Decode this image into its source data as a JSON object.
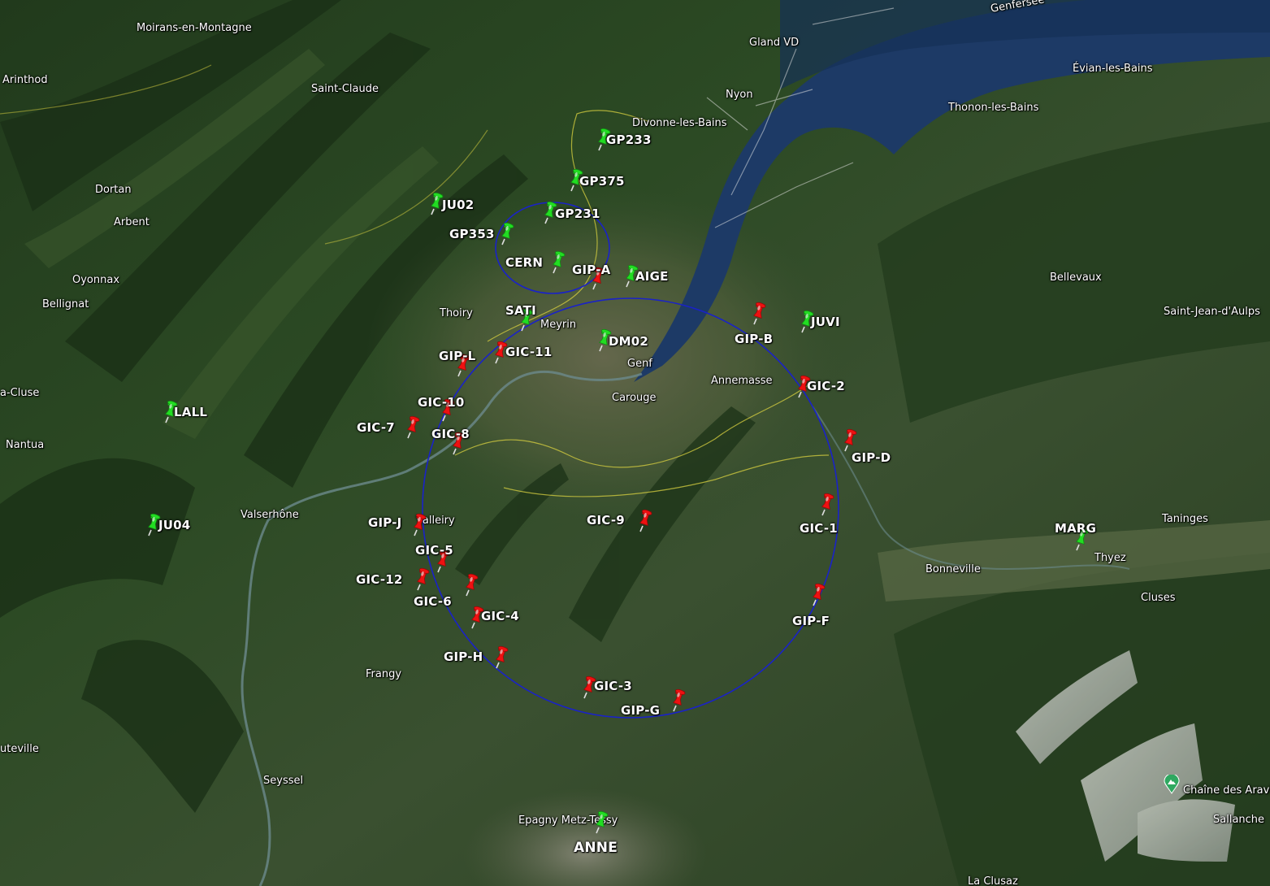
{
  "colors": {
    "ring": "#1a22c8",
    "pin_green": "#22dd22",
    "pin_red": "#ee1111",
    "lake": "#1d3a66",
    "border_yellow": "#d8d040",
    "border_white": "#e8e8e8"
  },
  "places": [
    {
      "id": "genfersee",
      "text": "Genfersee"
    },
    {
      "id": "moirans",
      "text": "Moirans-en-Montagne"
    },
    {
      "id": "gland",
      "text": "Gland VD"
    },
    {
      "id": "arinthod",
      "text": "Arinthod"
    },
    {
      "id": "saint-claude",
      "text": "Saint-Claude"
    },
    {
      "id": "nyon",
      "text": "Nyon"
    },
    {
      "id": "evian",
      "text": "Évian-les-Bains"
    },
    {
      "id": "thonon",
      "text": "Thonon-les-Bains"
    },
    {
      "id": "divonne",
      "text": "Divonne-les-Bains"
    },
    {
      "id": "dortan",
      "text": "Dortan"
    },
    {
      "id": "arbent",
      "text": "Arbent"
    },
    {
      "id": "oyonnax",
      "text": "Oyonnax"
    },
    {
      "id": "bellevaux",
      "text": "Bellevaux"
    },
    {
      "id": "bellignat",
      "text": "Bellignat"
    },
    {
      "id": "thoiry",
      "text": "Thoiry"
    },
    {
      "id": "saint-jean",
      "text": "Saint-Jean-d'Aulps"
    },
    {
      "id": "meyrin",
      "text": "Meyrin"
    },
    {
      "id": "genf",
      "text": "Genf"
    },
    {
      "id": "annemasse",
      "text": "Annemasse"
    },
    {
      "id": "carouge",
      "text": "Carouge"
    },
    {
      "id": "cluse",
      "text": "a-Cluse"
    },
    {
      "id": "nantua",
      "text": "Nantua"
    },
    {
      "id": "valserhone",
      "text": "Valserhône"
    },
    {
      "id": "valleiry",
      "text": "Valleiry"
    },
    {
      "id": "taninges",
      "text": "Taninges"
    },
    {
      "id": "thyez",
      "text": "Thyez"
    },
    {
      "id": "bonneville",
      "text": "Bonneville"
    },
    {
      "id": "cluses",
      "text": "Cluses"
    },
    {
      "id": "frangy",
      "text": "Frangy"
    },
    {
      "id": "uteville",
      "text": "uteville"
    },
    {
      "id": "seyssel",
      "text": "Seyssel"
    },
    {
      "id": "aravis",
      "text": "Chaîne des Aravis"
    },
    {
      "id": "sallanche",
      "text": "Sallanche"
    },
    {
      "id": "epagny",
      "text": "Epagny Metz-Tessy"
    },
    {
      "id": "clusaz",
      "text": "La Clusaz"
    }
  ],
  "pins": [
    {
      "id": "GP233",
      "label": "GP233",
      "color": "green"
    },
    {
      "id": "GP375",
      "label": "GP375",
      "color": "green"
    },
    {
      "id": "JU02",
      "label": "JU02",
      "color": "green"
    },
    {
      "id": "GP231",
      "label": "GP231",
      "color": "green"
    },
    {
      "id": "GP353",
      "label": "GP353",
      "color": "green"
    },
    {
      "id": "CERN",
      "label": "CERN",
      "color": "green"
    },
    {
      "id": "AIGE",
      "label": "AIGE",
      "color": "green"
    },
    {
      "id": "SATI",
      "label": "SATI",
      "color": "green"
    },
    {
      "id": "DM02",
      "label": "DM02",
      "color": "green"
    },
    {
      "id": "JUVI",
      "label": "JUVI",
      "color": "green"
    },
    {
      "id": "LALL",
      "label": "LALL",
      "color": "green"
    },
    {
      "id": "JU04",
      "label": "JU04",
      "color": "green"
    },
    {
      "id": "MARG",
      "label": "MARG",
      "color": "green"
    },
    {
      "id": "ANNE",
      "label": "ANNE",
      "color": "green"
    },
    {
      "id": "GIP-A",
      "label": "GIP-A",
      "color": "red"
    },
    {
      "id": "GIP-B",
      "label": "GIP-B",
      "color": "red"
    },
    {
      "id": "GIP-L",
      "label": "GIP-L",
      "color": "red"
    },
    {
      "id": "GIC-11",
      "label": "GIC-11",
      "color": "red"
    },
    {
      "id": "GIC-2",
      "label": "GIC-2",
      "color": "red"
    },
    {
      "id": "GIC-10",
      "label": "GIC-10",
      "color": "red"
    },
    {
      "id": "GIC-7",
      "label": "GIC-7",
      "color": "red"
    },
    {
      "id": "GIC-8",
      "label": "GIC-8",
      "color": "red"
    },
    {
      "id": "GIP-D",
      "label": "GIP-D",
      "color": "red"
    },
    {
      "id": "GIC-1",
      "label": "GIC-1",
      "color": "red"
    },
    {
      "id": "GIP-J",
      "label": "GIP-J",
      "color": "red"
    },
    {
      "id": "GIC-9",
      "label": "GIC-9",
      "color": "red"
    },
    {
      "id": "GIC-5",
      "label": "GIC-5",
      "color": "red"
    },
    {
      "id": "GIC-12",
      "label": "GIC-12",
      "color": "red"
    },
    {
      "id": "GIC-6",
      "label": "GIC-6",
      "color": "red"
    },
    {
      "id": "GIP-F",
      "label": "GIP-F",
      "color": "red"
    },
    {
      "id": "GIC-4",
      "label": "GIC-4",
      "color": "red"
    },
    {
      "id": "GIP-H",
      "label": "GIP-H",
      "color": "red"
    },
    {
      "id": "GIC-3",
      "label": "GIC-3",
      "color": "red"
    },
    {
      "id": "GIP-G",
      "label": "GIP-G",
      "color": "red"
    }
  ]
}
